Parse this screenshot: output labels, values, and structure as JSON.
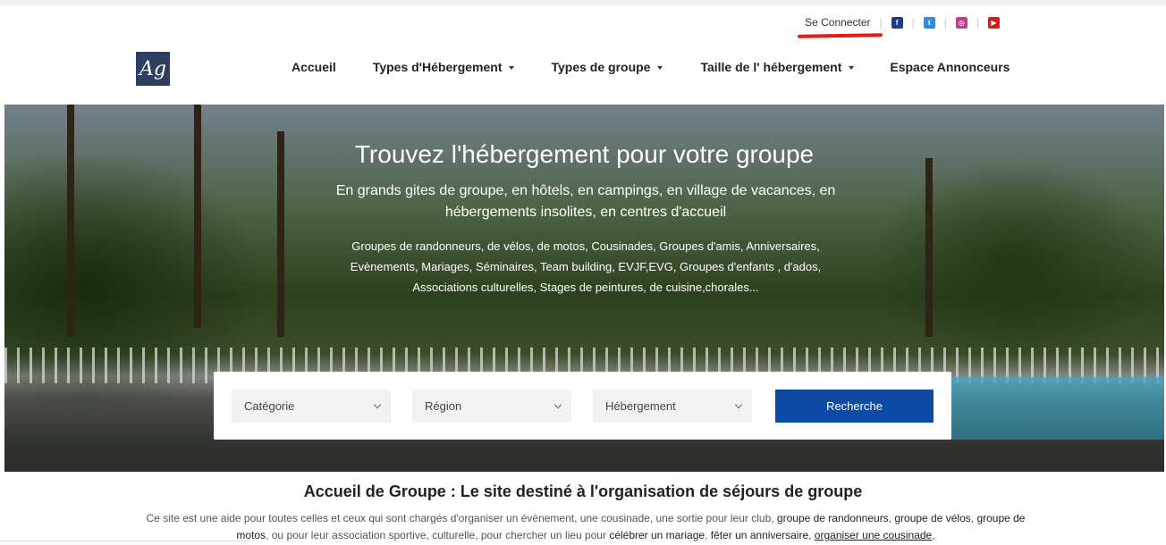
{
  "topbar": {
    "login": "Se Connecter",
    "social": [
      {
        "name": "facebook-icon",
        "glyph": "f",
        "color": "#1e3c8a"
      },
      {
        "name": "twitter-icon",
        "glyph": "t",
        "color": "#2a8ee0"
      },
      {
        "name": "instagram-icon",
        "glyph": "◎",
        "color": "#c73b8f"
      },
      {
        "name": "youtube-icon",
        "glyph": "▶",
        "color": "#d41e1e"
      }
    ]
  },
  "nav": {
    "logo": "Ag",
    "items": [
      {
        "label": "Accueil",
        "dropdown": false
      },
      {
        "label": "Types d'Hébergement",
        "dropdown": true
      },
      {
        "label": "Types de groupe",
        "dropdown": true
      },
      {
        "label": "Taille de l' hébergement",
        "dropdown": true
      },
      {
        "label": "Espace Annonceurs",
        "dropdown": false
      }
    ]
  },
  "hero": {
    "title": "Trouvez l'hébergement pour votre groupe",
    "subtitle": "En grands gites de groupe, en hôtels, en campings, en village de vacances, en hébergements insolites, en centres d'accueil",
    "description": "Groupes de randonneurs, de vélos, de motos, Cousinades, Groupes d'amis, Anniversaires, Evènements, Mariages, Séminaires, Team building, EVJF,EVG, Groupes d'enfants , d'ados, Associations culturelles, Stages de peintures, de cuisine,chorales..."
  },
  "search": {
    "category": "Catégorie",
    "region": "Région",
    "lodging": "Hébergement",
    "button": "Recherche"
  },
  "intro": {
    "title": "Accueil de Groupe : Le site destiné à l'organisation de séjours de groupe",
    "t1": "Ce site est une aide pour toutes celles et ceux qui sont chargés d'organiser un évènement, une cousinade, une sortie pour leur club, ",
    "t2": "groupe de randonneurs",
    "t3": ", ",
    "t4": "groupe de vélos",
    "t5": ", ",
    "t6": "groupe de motos",
    "t7": ", ou pour leur association sportive, culturelle, pour chercher un lieu pour ",
    "t8": "célébrer un mariage",
    "t9": ", ",
    "t10": "fêter un anniversaire",
    "t11": ", ",
    "t12": "organiser une cousinade",
    "t13": ","
  }
}
